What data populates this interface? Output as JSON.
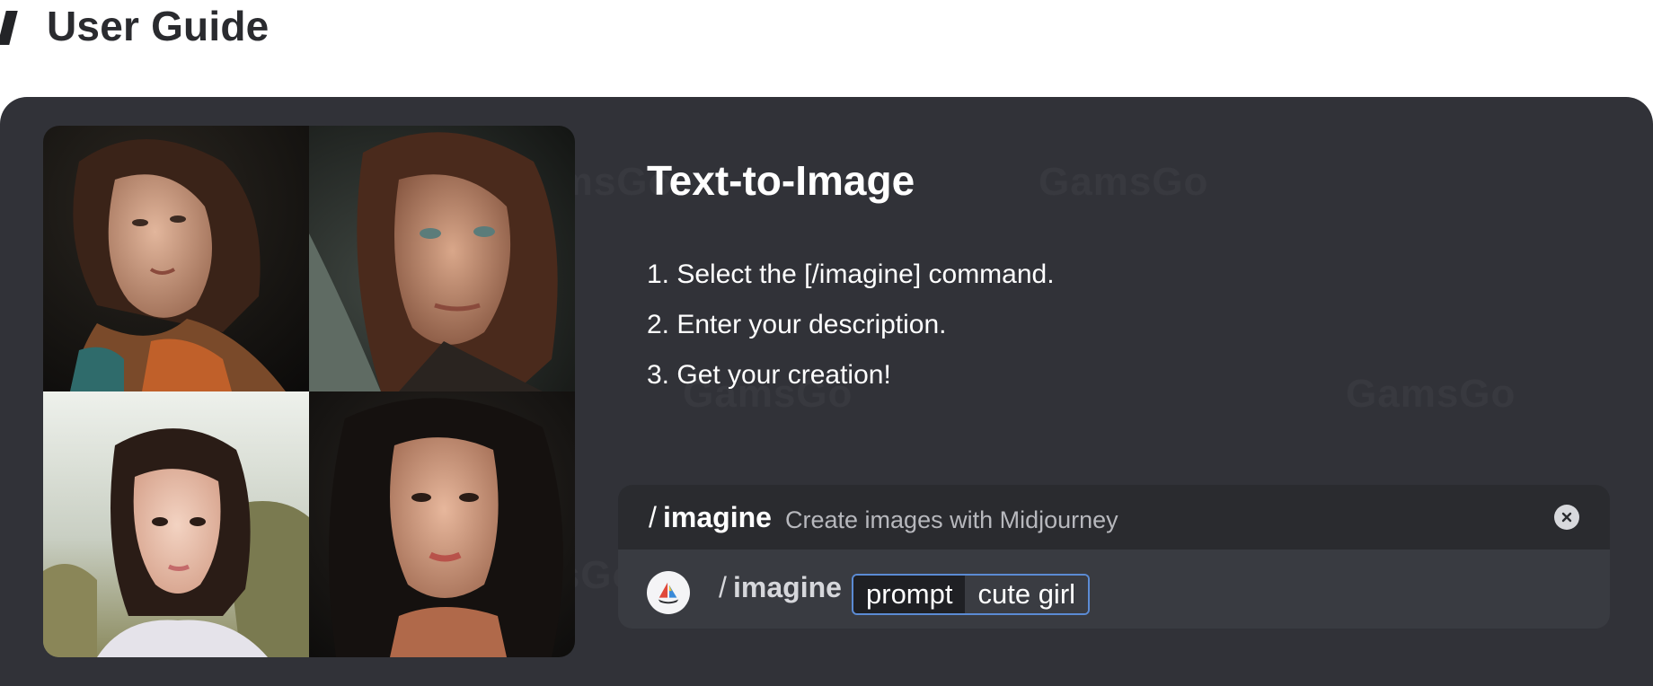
{
  "page": {
    "heading": "User Guide"
  },
  "card": {
    "watermark": "GamsGo",
    "title": "Text-to-Image",
    "steps": [
      "1. Select the [/imagine] command.",
      "2. Enter your description.",
      "3. Get your creation!"
    ],
    "gallery": [
      {
        "name": "portrait-woman-scarf"
      },
      {
        "name": "portrait-woman-freckles"
      },
      {
        "name": "portrait-girl-field"
      },
      {
        "name": "portrait-woman-dark-hair"
      }
    ]
  },
  "command": {
    "slash": "/",
    "name": "imagine",
    "description": "Create images with Midjourney",
    "close_icon": "close-circle-icon",
    "bot_icon": "midjourney-boat-icon",
    "option_name": "prompt",
    "option_value": "cute girl"
  },
  "colors": {
    "card_bg": "#313238",
    "panel_top": "#2a2b2f",
    "panel_bottom": "#393b41",
    "pill_border": "#5b8bd4"
  }
}
